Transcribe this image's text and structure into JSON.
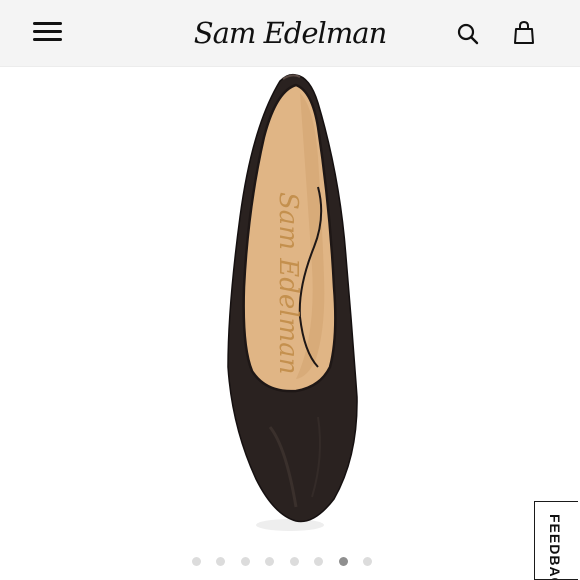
{
  "header": {
    "brand": "Sam Edelman",
    "menu_icon": "hamburger-menu-icon",
    "search_icon": "search-icon",
    "cart_icon": "shopping-bag-icon"
  },
  "product": {
    "image": "black-pointed-toe-pump-top-view",
    "insole_brand_text": "Sam Edelman"
  },
  "carousel": {
    "total_images": 8,
    "active_index": 6
  },
  "feedback": {
    "label": "FEEDBACK"
  },
  "colors": {
    "header_bg": "#f4f4f4",
    "dot_inactive": "#dcdcdc",
    "dot_active": "#8f8f8f",
    "shoe_leather": "#2a2220",
    "insole": "#e0b585"
  }
}
